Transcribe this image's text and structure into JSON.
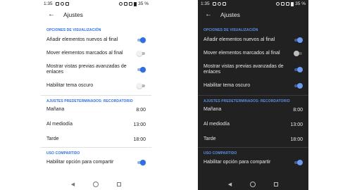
{
  "status": {
    "time": "1:35",
    "battery": "35 %"
  },
  "header": {
    "title": "Ajustes",
    "back_icon": "arrow-back-icon"
  },
  "sections": {
    "display": {
      "title": "OPCIONES DE VISUALIZACIÓN",
      "items": [
        {
          "label": "Añadir elementos nuevos al final",
          "on": true
        },
        {
          "label": "Mover elementos marcados al final",
          "on": false
        },
        {
          "label": "Mostrar vistas previas avanzadas de enlaces",
          "on": true
        },
        {
          "label": "Habilitar tema oscuro",
          "on_light": false,
          "on_dark": true
        }
      ]
    },
    "reminders": {
      "title": "AJUSTES PREDETERMINADOS: RECORDATORIO",
      "items": [
        {
          "label": "Mañana",
          "value": "8:00"
        },
        {
          "label": "Al mediodía",
          "value": "13:00"
        },
        {
          "label": "Tarde",
          "value": "18:00"
        }
      ]
    },
    "sharing": {
      "title": "USO COMPARTIDO",
      "items": [
        {
          "label": "Habilitar opción para compartir",
          "on": true
        }
      ]
    }
  },
  "colors": {
    "accent": "#2f6ee6",
    "dark_bg": "#212121",
    "light_bg": "#ffffff"
  }
}
